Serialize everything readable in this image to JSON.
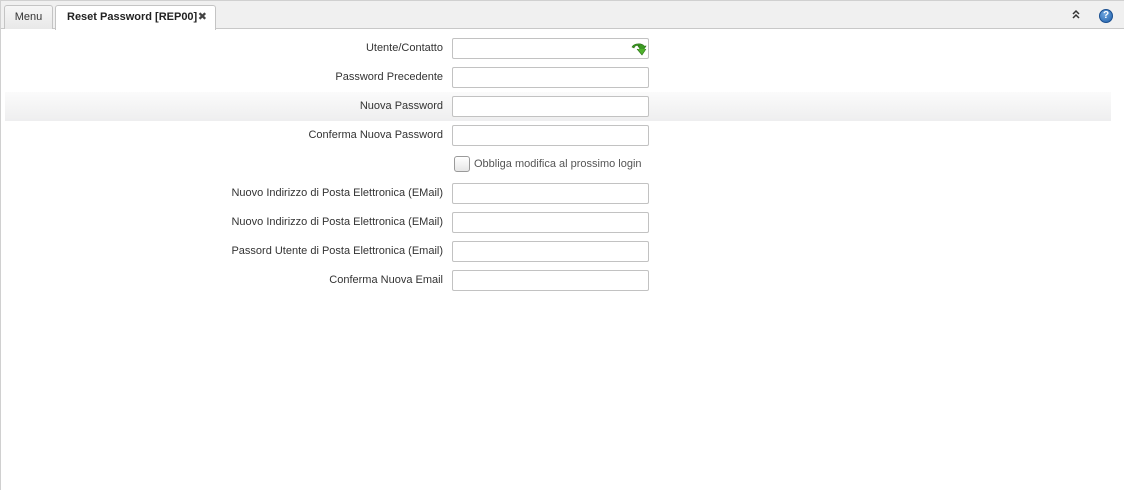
{
  "tabs": {
    "menu_label": "Menu",
    "active_label": "Reset Password [REP00]",
    "close_glyph": "✖"
  },
  "toolbar": {
    "collapse_glyph": "⌃",
    "help_glyph": "?"
  },
  "form": {
    "user_contact": {
      "label": "Utente/Contatto",
      "value": ""
    },
    "old_password": {
      "label": "Password Precedente",
      "value": ""
    },
    "new_password": {
      "label": "Nuova Password",
      "value": ""
    },
    "confirm_new_password": {
      "label": "Conferma Nuova Password",
      "value": ""
    },
    "force_change": {
      "label": "Obbliga modifica al prossimo login",
      "checked": false
    },
    "new_email_1": {
      "label": "Nuovo Indirizzo di Posta Elettronica (EMail)",
      "value": ""
    },
    "new_email_2": {
      "label": "Nuovo Indirizzo di Posta Elettronica (EMail)",
      "value": ""
    },
    "email_user_password": {
      "label": "Passord Utente di Posta Elettronica (Email)",
      "value": ""
    },
    "confirm_new_email": {
      "label": "Conferma Nuova Email",
      "value": ""
    }
  },
  "icons": {
    "lookup": "green-arrow-down-icon",
    "collapse": "chevron-up-double-icon",
    "help": "help-icon",
    "close": "close-icon"
  },
  "colors": {
    "lookup_green": "#3c9a22",
    "help_blue": "#1f5ea8"
  }
}
